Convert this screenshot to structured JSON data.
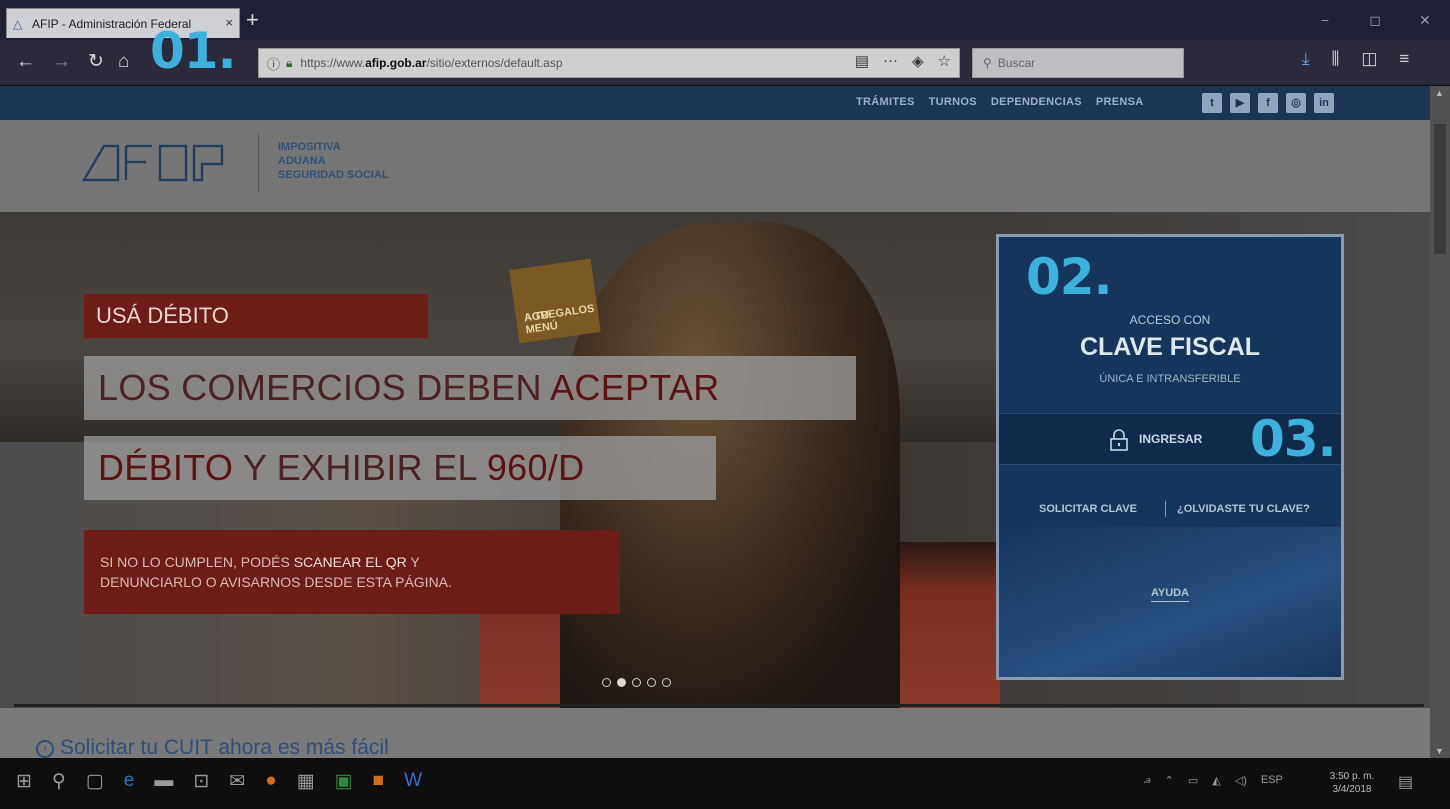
{
  "browser": {
    "tab_title": "AFIP - Administración Federal",
    "tab_close": "×",
    "new_tab": "+",
    "url_prefix": "https://www.",
    "url_domain": "afip.gob.ar",
    "url_path": "/sitio/externos/default.asp",
    "search_placeholder": "Buscar",
    "window_controls": [
      "−",
      "◻",
      "✕"
    ]
  },
  "site": {
    "nav_links": [
      "TRÁMITES",
      "TURNOS",
      "DEPENDENCIAS",
      "PRENSA"
    ],
    "social": [
      "twitter",
      "youtube",
      "facebook",
      "instagram",
      "linkedin"
    ],
    "social_glyphs": [
      "t",
      "▶",
      "f",
      "◎",
      "in"
    ],
    "brand_lines": [
      "IMPOSITIVA",
      "ADUANA",
      "SEGURIDAD SOCIAL"
    ]
  },
  "hero": {
    "tag": "USÁ DÉBITO",
    "headline1_a": "LOS COMERCIOS DEBEN ",
    "headline1_b": "ACEPTAR",
    "headline2_a": "DÉBITO",
    "headline2_b": " Y EXHIBIR EL ",
    "headline2_c": "960/D",
    "sub_a": "SI NO LO CUMPLEN, PODÉS ",
    "sub_b": "SCANEAR EL QR",
    "sub_c": " Y",
    "sub_d": "DENUNCIARLO O AVISARNOS DESDE ESTA PÁGINA.",
    "sign_text_1": "AGREGALOS",
    "sign_text_2": "A TU MENÚ",
    "slide_active": 2,
    "slide_count": 5
  },
  "login": {
    "acceso": "ACCESO CON",
    "clave": "CLAVE FISCAL",
    "unica": "ÚNICA E INTRANSFERIBLE",
    "ingresar": "INGRESAR",
    "solicitar": "SOLICITAR CLAVE",
    "olvidaste": "¿OLVIDASTE TU CLAVE?",
    "ayuda": "AYUDA"
  },
  "bottom": {
    "cuit_text": "Solicitar tu CUIT ahora es más fácil"
  },
  "annotations": [
    "01.",
    "02.",
    "03."
  ],
  "taskbar": {
    "lang": "ESP",
    "time": "3:50 p. m.",
    "date": "3/4/2018"
  },
  "colors": {
    "annotation": "#3cb1de",
    "login_bg": "#15355d",
    "hero_red": "#6e1c18",
    "top_strip": "#1b3553"
  }
}
